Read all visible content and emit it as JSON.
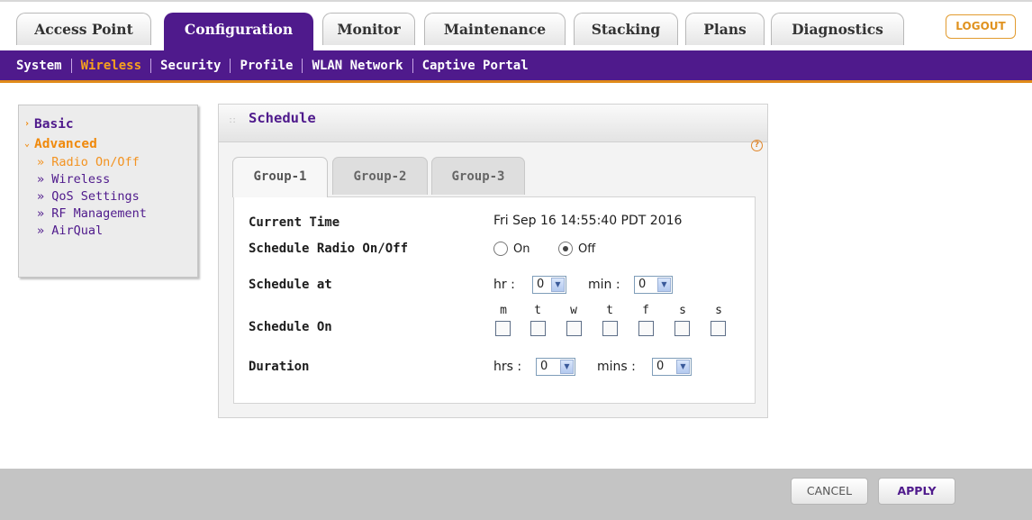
{
  "top_tabs": [
    {
      "label": "Access Point",
      "active": false
    },
    {
      "label": "Configuration",
      "active": true
    },
    {
      "label": "Monitor",
      "active": false
    },
    {
      "label": "Maintenance",
      "active": false
    },
    {
      "label": "Stacking",
      "active": false
    },
    {
      "label": "Plans",
      "active": false
    },
    {
      "label": "Diagnostics",
      "active": false
    }
  ],
  "logout_label": "LOGOUT",
  "sub_nav": [
    {
      "label": "System",
      "active": false
    },
    {
      "label": "Wireless",
      "active": true
    },
    {
      "label": "Security",
      "active": false
    },
    {
      "label": "Profile",
      "active": false
    },
    {
      "label": "WLAN Network",
      "active": false
    },
    {
      "label": "Captive Portal",
      "active": false
    }
  ],
  "left_menu": {
    "basic": "Basic",
    "advanced": "Advanced",
    "items": [
      "» Radio On/Off",
      "» Wireless",
      "» QoS Settings",
      "» RF Management",
      "» AirQual"
    ],
    "active_item": "» Radio On/Off"
  },
  "panel": {
    "title": "Schedule",
    "help": "?",
    "group_tabs": [
      "Group-1",
      "Group-2",
      "Group-3"
    ],
    "active_group": "Group-1",
    "current_time_label": "Current Time",
    "current_time_value": "Fri Sep 16 14:55:40 PDT 2016",
    "radio_label": "Schedule Radio On/Off",
    "radio_options": [
      "On",
      "Off"
    ],
    "radio_selected": "Off",
    "schedule_at_label": "Schedule at",
    "hr_label": "hr :",
    "hr_value": "0",
    "min_label": "min :",
    "min_value": "0",
    "schedule_on_label": "Schedule On",
    "days": [
      "m",
      "t",
      "w",
      "t",
      "f",
      "s",
      "s"
    ],
    "duration_label": "Duration",
    "hrs_label": "hrs :",
    "hrs_value": "0",
    "mins_label": "mins :",
    "mins_value": "0"
  },
  "footer": {
    "cancel": "CANCEL",
    "apply": "APPLY"
  },
  "colors": {
    "brand_purple": "#4f1a8c",
    "accent_orange": "#e08a1a"
  }
}
